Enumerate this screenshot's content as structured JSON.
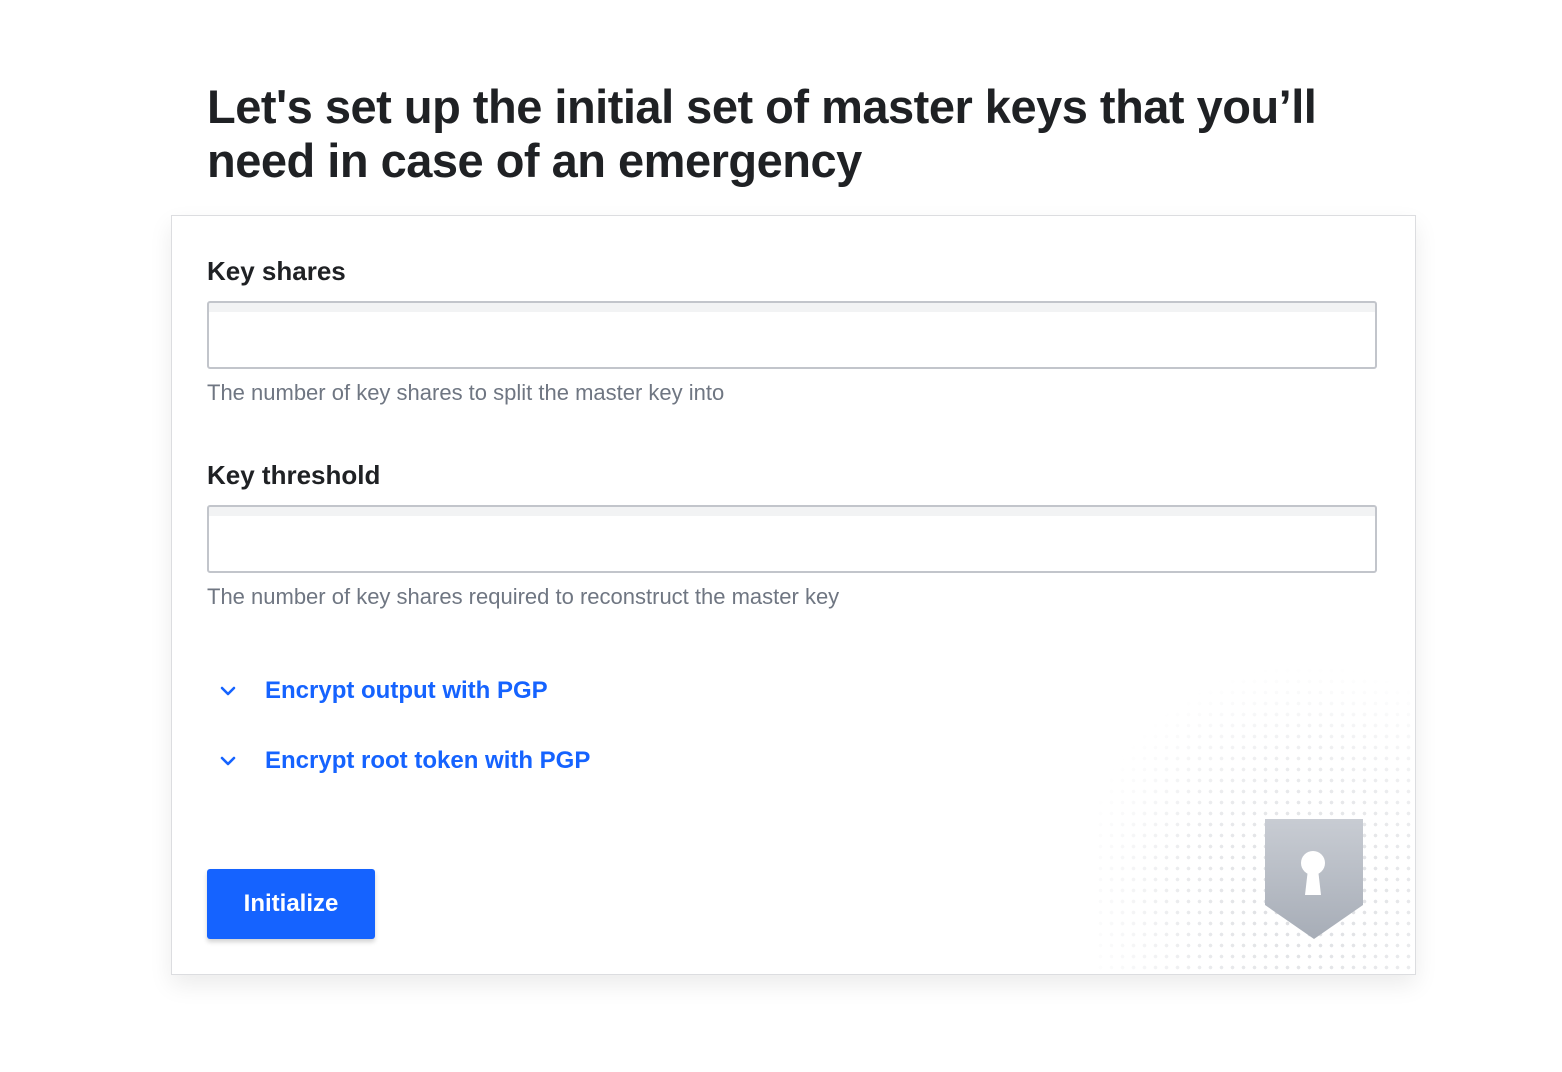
{
  "page": {
    "title": "Let's set up the initial set of master keys that you’ll need in case of an emergency"
  },
  "form": {
    "key_shares": {
      "label": "Key shares",
      "value": "",
      "help": "The number of key shares to split the master key into"
    },
    "key_threshold": {
      "label": "Key threshold",
      "value": "",
      "help": "The number of key shares required to reconstruct the master key"
    },
    "toggles": [
      {
        "label": "Encrypt output with PGP",
        "icon": "chevron-down-icon"
      },
      {
        "label": "Encrypt root token with PGP",
        "icon": "chevron-down-icon"
      }
    ],
    "submit_label": "Initialize"
  },
  "decoration": {
    "icon": "shield-keyhole-icon"
  },
  "colors": {
    "accent": "#1563ff",
    "title": "#1f2124",
    "help_text": "#6f7682",
    "border": "#c2c5cb",
    "shield": "#b4b9c2"
  }
}
